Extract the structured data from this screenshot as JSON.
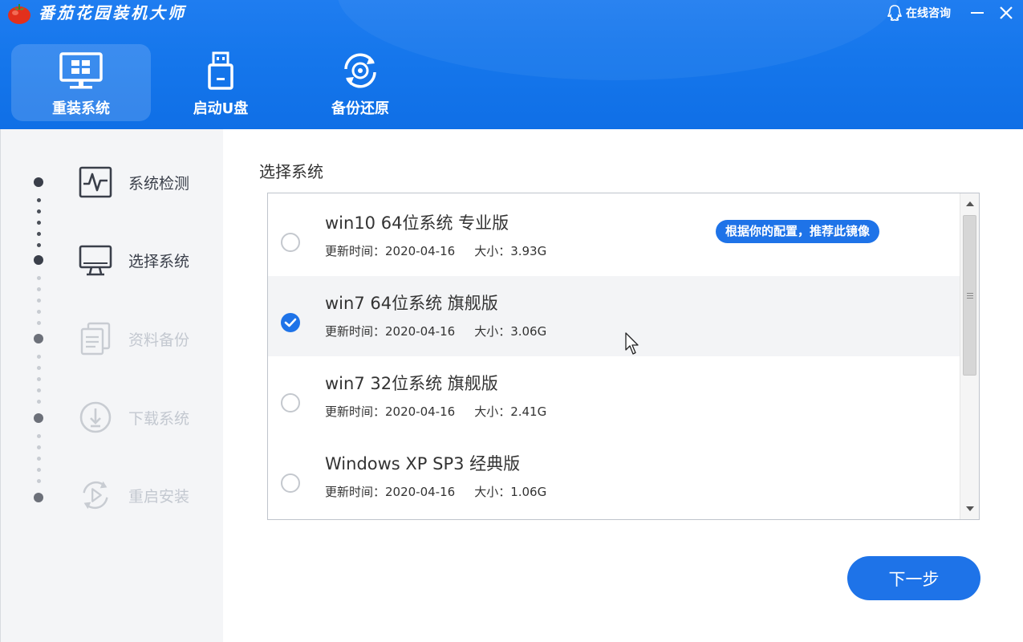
{
  "app": {
    "title": "番茄花园装机大师"
  },
  "window": {
    "consult_label": "在线咨询"
  },
  "nav": {
    "tabs": [
      {
        "label": "重装系统",
        "icon": "monitor-icon",
        "active": true
      },
      {
        "label": "启动U盘",
        "icon": "usb-drive-icon",
        "active": false
      },
      {
        "label": "备份还原",
        "icon": "backup-restore-icon",
        "active": false
      }
    ]
  },
  "steps": [
    {
      "label": "系统检测",
      "icon": "pulse-monitor-icon",
      "state": "done"
    },
    {
      "label": "选择系统",
      "icon": "desktop-icon",
      "state": "done"
    },
    {
      "label": "资料备份",
      "icon": "documents-icon",
      "state": "todo"
    },
    {
      "label": "下载系统",
      "icon": "download-icon",
      "state": "todo"
    },
    {
      "label": "重启安装",
      "icon": "restart-icon",
      "state": "todo"
    }
  ],
  "main": {
    "section_title": "选择系统",
    "systems": [
      {
        "name": "win10 64位系统 专业版",
        "updated": "更新时间：2020-04-16",
        "size": "大小：3.93G",
        "selected": false,
        "badge": "根据你的配置，推荐此镜像"
      },
      {
        "name": "win7 64位系统 旗舰版",
        "updated": "更新时间：2020-04-16",
        "size": "大小：3.06G",
        "selected": true
      },
      {
        "name": "win7 32位系统 旗舰版",
        "updated": "更新时间：2020-04-16",
        "size": "大小：2.41G",
        "selected": false
      },
      {
        "name": "Windows XP SP3 经典版",
        "updated": "更新时间：2020-04-16",
        "size": "大小：1.06G",
        "selected": false
      }
    ],
    "next_label": "下一步"
  },
  "colors": {
    "header_blue": "#1677ec",
    "accent_blue": "#1e73e8",
    "step_done": "#3a3f4a",
    "step_todo": "#c3c8d0"
  }
}
